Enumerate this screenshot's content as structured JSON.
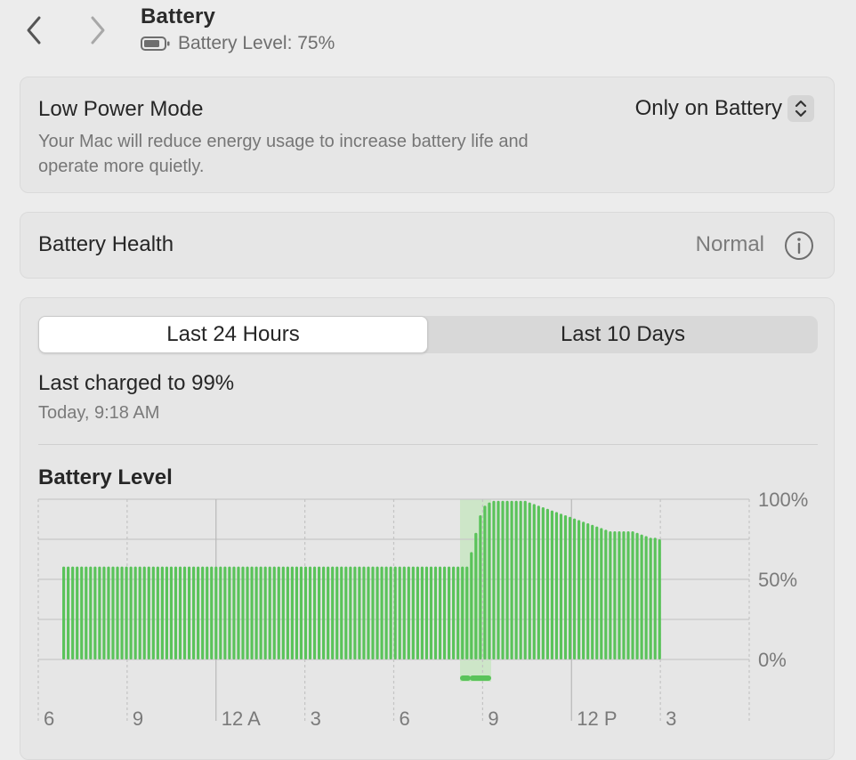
{
  "header": {
    "title": "Battery",
    "battery_level_text": "Battery Level: 75%",
    "back_icon": "chevron-left-icon",
    "forward_icon": "chevron-right-icon",
    "battery_icon": "battery-icon"
  },
  "low_power_mode": {
    "title": "Low Power Mode",
    "description": "Your Mac will reduce energy usage to increase battery life and operate more quietly.",
    "selected_option": "Only on Battery",
    "stepper_icon": "up-down-chevron-icon"
  },
  "battery_health": {
    "label": "Battery Health",
    "value": "Normal",
    "info_icon": "info-circle-icon"
  },
  "usage": {
    "tabs": [
      {
        "label": "Last 24 Hours",
        "selected": true
      },
      {
        "label": "Last 10 Days",
        "selected": false
      }
    ],
    "last_charged": "Last charged to 99%",
    "last_charged_time": "Today, 9:18 AM"
  },
  "colors": {
    "bar_green": "#5ac35a",
    "charging_band": "#cde6c8",
    "background": "#ececec",
    "card": "#e6e6e6"
  },
  "chart_data": {
    "type": "bar",
    "title": "Battery Level",
    "y_unit": "%",
    "ylim": [
      0,
      100
    ],
    "y_tick_labels": [
      "100%",
      "50%",
      "0%"
    ],
    "x_tick_labels": [
      "6",
      "9",
      "12 A",
      "3",
      "6",
      "9",
      "12 P",
      "3"
    ],
    "grid": true,
    "charging_indicator": true,
    "values": [
      58,
      58,
      58,
      58,
      58,
      58,
      58,
      58,
      58,
      58,
      58,
      58,
      58,
      58,
      58,
      58,
      58,
      58,
      58,
      58,
      58,
      58,
      58,
      58,
      58,
      58,
      58,
      58,
      58,
      58,
      58,
      58,
      58,
      58,
      58,
      58,
      58,
      58,
      58,
      58,
      58,
      58,
      58,
      58,
      58,
      58,
      58,
      58,
      58,
      58,
      58,
      58,
      58,
      58,
      58,
      58,
      58,
      58,
      58,
      58,
      58,
      58,
      58,
      58,
      58,
      58,
      58,
      58,
      58,
      58,
      58,
      58,
      58,
      58,
      58,
      58,
      58,
      58,
      58,
      58,
      58,
      58,
      58,
      58,
      58,
      58,
      58,
      58,
      58,
      58,
      58,
      67,
      79,
      90,
      96,
      98,
      99,
      99,
      99,
      99,
      99,
      99,
      99,
      99,
      98,
      97,
      96,
      95,
      94,
      93,
      92,
      91,
      90,
      89,
      88,
      87,
      86,
      85,
      84,
      83,
      82,
      81,
      80,
      80,
      80,
      80,
      80,
      80,
      79,
      78,
      77,
      76,
      76,
      75
    ]
  }
}
